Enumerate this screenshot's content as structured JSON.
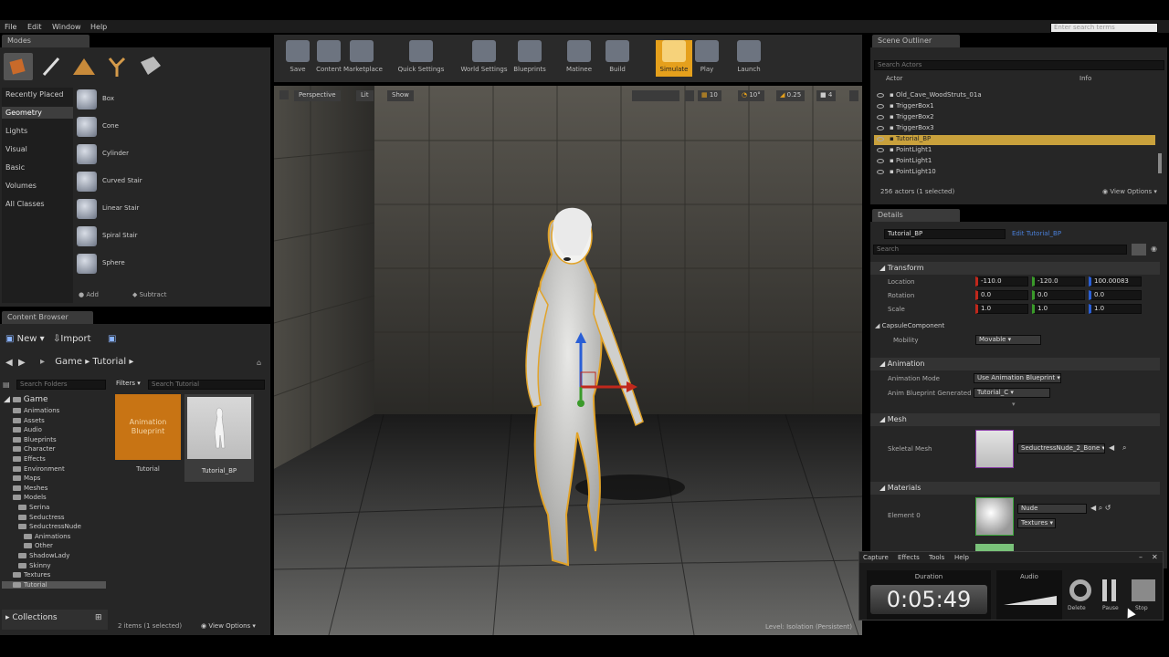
{
  "menu": [
    "File",
    "Edit",
    "Window",
    "Help"
  ],
  "search_docs_placeholder": "Enter search terms",
  "modes": {
    "tab": "Modes",
    "categories": [
      "Recently Placed",
      "Geometry",
      "Lights",
      "Visual",
      "Basic",
      "Volumes",
      "All Classes"
    ],
    "items": [
      "Box",
      "Cone",
      "Cylinder",
      "Curved Stair",
      "Linear Stair",
      "Spiral Stair",
      "Sphere"
    ],
    "add_label": "Add",
    "subtract_label": "Subtract"
  },
  "toolbar": {
    "buttons": [
      "Save",
      "Content",
      "Marketplace",
      "Quick Settings",
      "World Settings",
      "Blueprints",
      "Matinee",
      "Build",
      "Simulate",
      "Play",
      "Launch"
    ]
  },
  "viewport": {
    "perspective": "Perspective",
    "lit": "Lit",
    "show": "Show",
    "snap_grid": "10",
    "snap_rot": "10°",
    "snap_scale": "0.25",
    "camera_speed": "4",
    "level_label": "Level:",
    "level_name": "Isolation (Persistent)"
  },
  "content_browser": {
    "tab": "Content Browser",
    "new_label": "New",
    "import_label": "Import",
    "path": [
      "Game",
      "Tutorial"
    ],
    "search_folders_placeholder": "Search Folders",
    "filters_label": "Filters",
    "search_placeholder": "Search Tutorial",
    "root": "Game",
    "folders": [
      {
        "name": "Animations",
        "depth": 1
      },
      {
        "name": "Assets",
        "depth": 1
      },
      {
        "name": "Audio",
        "depth": 1
      },
      {
        "name": "Blueprints",
        "depth": 1
      },
      {
        "name": "Character",
        "depth": 1
      },
      {
        "name": "Effects",
        "depth": 1
      },
      {
        "name": "Environment",
        "depth": 1
      },
      {
        "name": "Maps",
        "depth": 1
      },
      {
        "name": "Meshes",
        "depth": 1
      },
      {
        "name": "Models",
        "depth": 1
      },
      {
        "name": "Serina",
        "depth": 2
      },
      {
        "name": "Seductress",
        "depth": 2
      },
      {
        "name": "SeductressNude",
        "depth": 2
      },
      {
        "name": "Animations",
        "depth": 3
      },
      {
        "name": "Other",
        "depth": 3
      },
      {
        "name": "ShadowLady",
        "depth": 2
      },
      {
        "name": "Skinny",
        "depth": 2
      },
      {
        "name": "Textures",
        "depth": 1
      },
      {
        "name": "Tutorial",
        "depth": 1
      }
    ],
    "assets": [
      {
        "name": "Tutorial",
        "thumb_text": "Animation Blueprint"
      },
      {
        "name": "Tutorial_BP",
        "thumb_text": ""
      }
    ],
    "status": "2 items (1 selected)",
    "view_options": "View Options",
    "collections_label": "Collections"
  },
  "outliner": {
    "tab": "Scene Outliner",
    "search_placeholder": "Search Actors",
    "col_actor": "Actor",
    "col_info": "Info",
    "rows": [
      "Old_Cave_WoodStruts_01a",
      "TriggerBox1",
      "TriggerBox2",
      "TriggerBox3",
      "Tutorial_BP",
      "PointLight1",
      "PointLight1",
      "PointLight10"
    ],
    "selected_index": 4,
    "status": "256 actors (1 selected)",
    "view_options": "View Options"
  },
  "details": {
    "tab": "Details",
    "name_value": "Tutorial_BP",
    "edit_link": "Edit Tutorial_BP",
    "search_placeholder": "Search",
    "transform_header": "Transform",
    "location_label": "Location",
    "rotation_label": "Rotation",
    "scale_label": "Scale",
    "location": [
      "-110.0",
      "-120.0",
      "100.00083"
    ],
    "rotation": [
      "0.0",
      "0.0",
      "0.0"
    ],
    "scale": [
      "1.0",
      "1.0",
      "1.0"
    ],
    "capsule_label": "CapsuleComponent",
    "mobility_label": "Mobility",
    "mobility_value": "Movable",
    "animation_header": "Animation",
    "anim_mode_label": "Animation Mode",
    "anim_mode_value": "Use Animation Blueprint",
    "anim_bp_label": "Anim Blueprint Generated",
    "anim_bp_value": "Tutorial_C",
    "mesh_header": "Mesh",
    "skeletal_mesh_label": "Skeletal Mesh",
    "skeletal_mesh_value": "SeductressNude_2_Bone",
    "materials_header": "Materials",
    "element_label": "Element 0",
    "material_value": "Nude",
    "textures_label": "Textures"
  },
  "recorder": {
    "menu": [
      "Capture",
      "Effects",
      "Tools",
      "Help"
    ],
    "duration_label": "Duration",
    "duration_value": "0:05:49",
    "audio_label": "Audio",
    "delete_label": "Delete",
    "pause_label": "Pause",
    "stop_label": "Stop"
  },
  "colors": {
    "accent": "#e5a01c",
    "selection": "#c9a13c",
    "asset_orange": "#c87414"
  }
}
